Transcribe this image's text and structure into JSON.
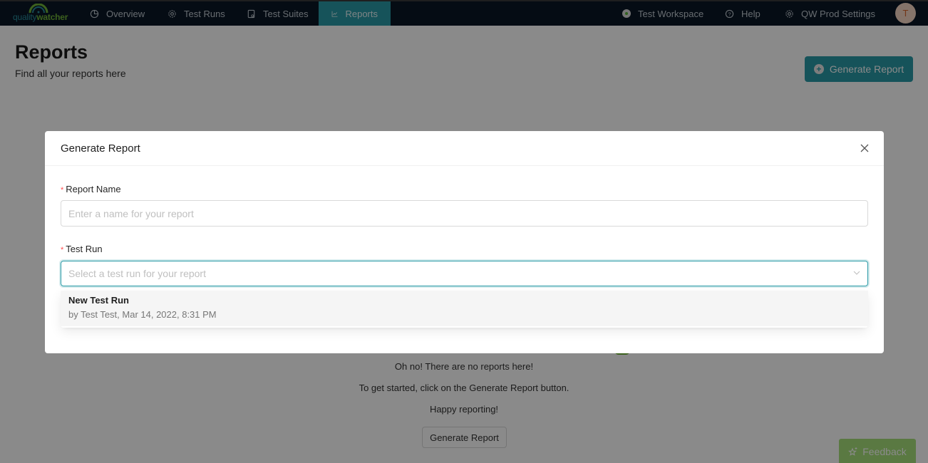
{
  "brand": {
    "logo_part1": "quality",
    "logo_part2": "watcher",
    "accent": "#2a9aa6",
    "green": "#6fb338"
  },
  "nav": {
    "items": [
      {
        "label": "Overview",
        "icon": "pie-chart-icon"
      },
      {
        "label": "Test Runs",
        "icon": "gear-icon"
      },
      {
        "label": "Test Suites",
        "icon": "clipboard-icon"
      },
      {
        "label": "Reports",
        "icon": "line-chart-icon",
        "active": true
      }
    ],
    "workspace": "Test Workspace",
    "help": "Help",
    "settings": "QW Prod Settings",
    "avatar_initial": "T"
  },
  "page": {
    "title": "Reports",
    "subtitle": "Find all your reports here",
    "generate_button": "Generate Report"
  },
  "empty_state": {
    "line1": "Oh no! There are no reports here!",
    "line2": "To get started, click on the Generate Report button.",
    "line3": "Happy reporting!",
    "button": "Generate Report"
  },
  "feedback": {
    "label": "Feedback"
  },
  "modal": {
    "title": "Generate Report",
    "report_name_label": "Report Name",
    "report_name_placeholder": "Enter a name for your report",
    "report_name_value": "",
    "test_run_label": "Test Run",
    "test_run_placeholder": "Select a test run for your report",
    "options": [
      {
        "title": "New Test Run",
        "subtitle": "by Test Test, Mar 14, 2022, 8:31 PM"
      }
    ]
  }
}
